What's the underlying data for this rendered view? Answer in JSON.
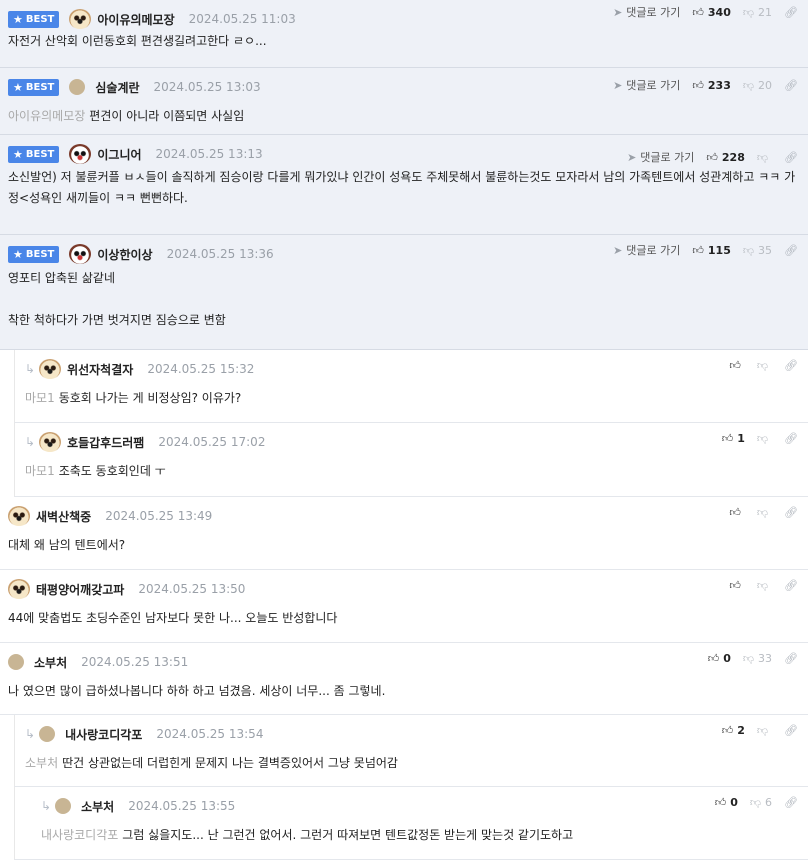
{
  "comments": [
    {
      "best": true,
      "best_label": "BEST",
      "avatar": "dog-avatar",
      "nick": "아이유의메모장",
      "date": "2024.05.25 11:03",
      "reply_label": "댓글로 가기",
      "likes": "340",
      "dislikes": "21",
      "mention": "",
      "text": "자전거 산악회 이런동호회 편견생길려고한다 ㄹㅇ..."
    },
    {
      "best": true,
      "best_label": "BEST",
      "avatar": "dot-avatar",
      "nick": "심술계란",
      "date": "2024.05.25 13:03",
      "reply_label": "댓글로 가기",
      "likes": "233",
      "dislikes": "20",
      "mention": "아이유의메모장",
      "text": "편견이 아니라 이쯤되면 사실임"
    },
    {
      "best": true,
      "best_label": "BEST",
      "avatar": "bear-avatar",
      "nick": "이그니어",
      "date": "2024.05.25 13:13",
      "reply_label": "댓글로 가기",
      "likes": "228",
      "dislikes": "",
      "mention": "",
      "text": "소신발언) 저 불륜커플 ㅂㅅ들이 솔직하게 짐승이랑 다를게 뭐가있냐 인간이 성욕도 주체못해서 불륜하는것도 모자라서 남의 가족텐트에서 성관계하고 ㅋㅋ 가정<성욕인 새끼들이 ㅋㅋ 뻔뻔하다."
    },
    {
      "best": true,
      "best_label": "BEST",
      "avatar": "bear-avatar",
      "nick": "이상한이상",
      "date": "2024.05.25 13:36",
      "reply_label": "댓글로 가기",
      "likes": "115",
      "dislikes": "35",
      "mention": "",
      "text": "영포티 압축된 삶같네",
      "text2": "착한 척하다가 가면 벗겨지면 짐승으로 변함"
    },
    {
      "best": false,
      "depth": 1,
      "avatar": "dog-avatar",
      "nick": "위선자척결자",
      "date": "2024.05.25 15:32",
      "likes": "",
      "dislikes": "",
      "mention": "마모1",
      "text": "동호회 나가는 게 비정상임? 이유가?"
    },
    {
      "best": false,
      "depth": 1,
      "avatar": "dog-avatar",
      "nick": "호들갑후드러팸",
      "date": "2024.05.25 17:02",
      "likes": "1",
      "dislikes": "",
      "mention": "마모1",
      "text": "조축도 동호회인데 ㅜ"
    },
    {
      "best": false,
      "depth": 0,
      "avatar": "dog-avatar",
      "nick": "새벽산책중",
      "date": "2024.05.25 13:49",
      "likes": "",
      "dislikes": "",
      "mention": "",
      "text": "대체 왜 남의 텐트에서?"
    },
    {
      "best": false,
      "depth": 0,
      "avatar": "dog-avatar",
      "nick": "태평양어깨갖고파",
      "date": "2024.05.25 13:50",
      "likes": "",
      "dislikes": "",
      "mention": "",
      "text": "44에 맞춤법도 초딩수준인 남자보다 못한 나... 오늘도 반성합니다"
    },
    {
      "best": false,
      "depth": 0,
      "avatar": "dot-avatar",
      "nick": "소부처",
      "date": "2024.05.25 13:51",
      "likes": "0",
      "dislikes": "33",
      "mention": "",
      "text": "나 였으면 많이 급하셨나봅니다 하하 하고 넘겼음. 세상이 너무... 좀 그렇네."
    },
    {
      "best": false,
      "depth": 1,
      "avatar": "dot-avatar",
      "nick": "내사랑코디각포",
      "date": "2024.05.25 13:54",
      "likes": "2",
      "dislikes": "",
      "mention": "소부처",
      "text": "딴건 상관없는데 더럽힌게 문제지 나는 결벽증있어서 그냥 못넘어감"
    },
    {
      "best": false,
      "depth": 2,
      "avatar": "dot-avatar",
      "nick": "소부처",
      "date": "2024.05.25 13:55",
      "likes": "0",
      "dislikes": "6",
      "mention": "내사랑코디각포",
      "text": "그럼 싫을지도... 난 그런건 없어서. 그런거 따져보면 텐트값정돈 받는게 맞는것 같기도하고"
    }
  ]
}
